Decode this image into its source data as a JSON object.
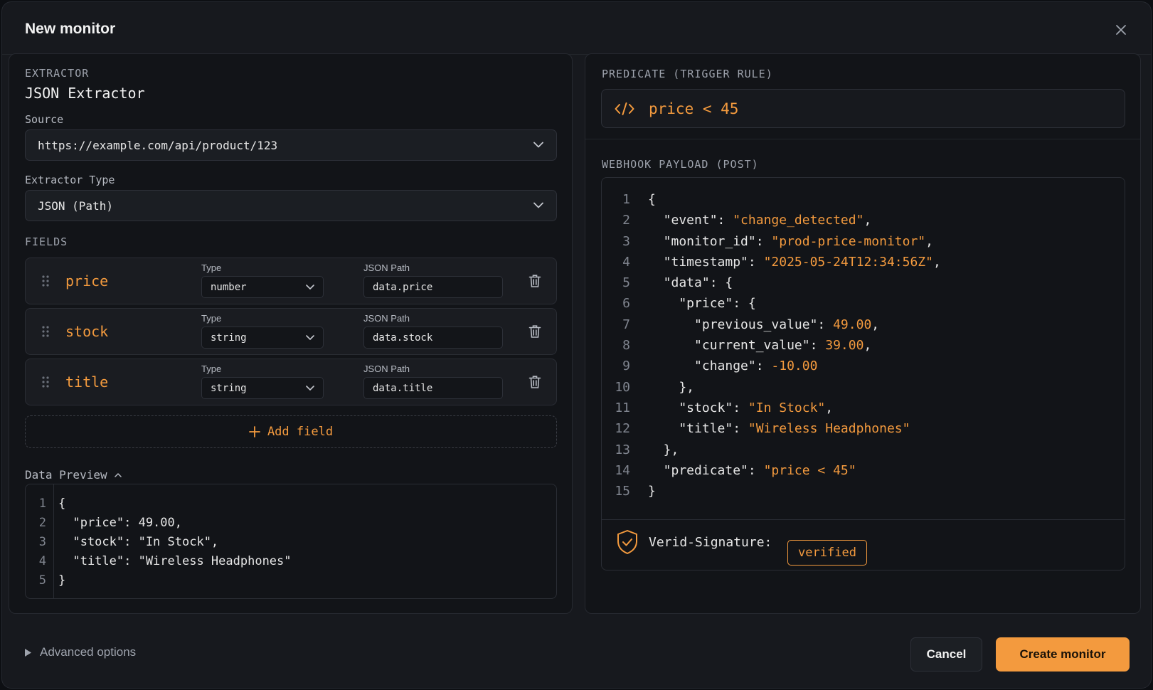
{
  "modal": {
    "title": "New monitor"
  },
  "extractor": {
    "section_label": "EXTRACTOR",
    "title": "JSON Extractor",
    "source_label": "Source",
    "source_value": "https://example.com/api/product/123",
    "type_label": "Extractor Type",
    "type_value": "JSON (Path)"
  },
  "fields": {
    "section_label": "FIELDS",
    "type_label": "Type",
    "path_label": "JSON Path",
    "items": [
      {
        "name": "price",
        "type": "number",
        "path": "data.price"
      },
      {
        "name": "stock",
        "type": "string",
        "path": "data.stock"
      },
      {
        "name": "title",
        "type": "string",
        "path": "data.title"
      }
    ],
    "add_label": "Add field"
  },
  "data_preview": {
    "label": "Data Preview",
    "line_numbers": [
      "1",
      "2",
      "3",
      "4",
      "5"
    ],
    "lines": [
      "{",
      "  \"price\": 49.00,",
      "  \"stock\": \"In Stock\",",
      "  \"title\": \"Wireless Headphones\"",
      "}"
    ]
  },
  "predicate": {
    "section_label": "PREDICATE (TRIGGER RULE)",
    "expression": "price < 45"
  },
  "webhook": {
    "section_label": "WEBHOOK PAYLOAD (POST)",
    "line_numbers": [
      "1",
      "2",
      "3",
      "4",
      "5",
      "6",
      "7",
      "8",
      "9",
      "10",
      "11",
      "12",
      "13",
      "14",
      "15"
    ],
    "lines": [
      {
        "pre": "{",
        "val": "",
        "post": ""
      },
      {
        "pre": "  \"event\": ",
        "val": "\"change_detected\"",
        "post": ","
      },
      {
        "pre": "  \"monitor_id\": ",
        "val": "\"prod-price-monitor\"",
        "post": ","
      },
      {
        "pre": "  \"timestamp\": ",
        "val": "\"2025-05-24T12:34:56Z\"",
        "post": ","
      },
      {
        "pre": "  \"data\": {",
        "val": "",
        "post": ""
      },
      {
        "pre": "    \"price\": {",
        "val": "",
        "post": ""
      },
      {
        "pre": "      \"previous_value\": ",
        "val": "49.00",
        "post": ","
      },
      {
        "pre": "      \"current_value\": ",
        "val": "39.00",
        "post": ","
      },
      {
        "pre": "      \"change\": ",
        "val": "-10.00",
        "post": ""
      },
      {
        "pre": "    },",
        "val": "",
        "post": ""
      },
      {
        "pre": "    \"stock\": ",
        "val": "\"In Stock\"",
        "post": ","
      },
      {
        "pre": "    \"title\": ",
        "val": "\"Wireless Headphones\"",
        "post": ""
      },
      {
        "pre": "  },",
        "val": "",
        "post": ""
      },
      {
        "pre": "  \"predicate\": ",
        "val": "\"price < 45\"",
        "post": ""
      },
      {
        "pre": "}",
        "val": "",
        "post": ""
      }
    ],
    "signature_label": "Verid-Signature:",
    "signature_status": "verified"
  },
  "footer": {
    "advanced_label": "Advanced options",
    "cancel_label": "Cancel",
    "create_label": "Create monitor"
  },
  "colors": {
    "accent": "#f39a3e",
    "background": "#17191e",
    "panel": "#121418"
  },
  "icons": [
    "close-icon",
    "chevron-down-icon",
    "drag-handle-icon",
    "trash-icon",
    "plus-icon",
    "chevron-up-icon",
    "code-icon",
    "shield-check-icon",
    "triangle-right-icon"
  ]
}
